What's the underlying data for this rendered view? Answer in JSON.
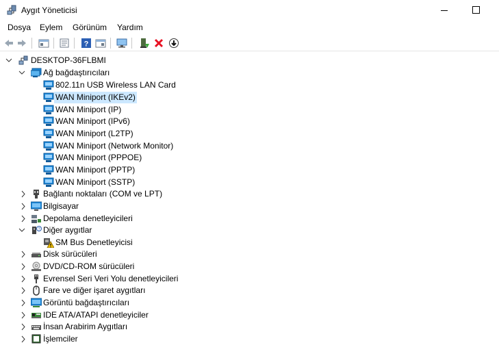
{
  "window": {
    "title": "Aygıt Yöneticisi"
  },
  "menu": [
    "Dosya",
    "Eylem",
    "Görünüm",
    "Yardım"
  ],
  "toolbar": {
    "icons": [
      "back-icon",
      "forward-icon",
      "show-hide-tree-icon",
      "properties-icon",
      "help-icon",
      "view-icon",
      "monitor-icon",
      "update-driver-icon",
      "uninstall-icon",
      "download-icon"
    ]
  },
  "tree": {
    "root": "DESKTOP-36FLBMI",
    "network": {
      "label": "Ağ bağdaştırıcıları",
      "items": [
        "802.11n USB Wireless LAN Card",
        "WAN Miniport (IKEv2)",
        "WAN Miniport (IP)",
        "WAN Miniport (IPv6)",
        "WAN Miniport (L2TP)",
        "WAN Miniport (Network Monitor)",
        "WAN Miniport (PPPOE)",
        "WAN Miniport (PPTP)",
        "WAN Miniport (SSTP)"
      ],
      "selected_index": 1
    },
    "categories_a": [
      "Bağlantı noktaları (COM ve LPT)",
      "Bilgisayar",
      "Depolama denetleyicileri"
    ],
    "other": {
      "label": "Diğer aygıtlar",
      "items": [
        "SM Bus Denetleyicisi"
      ]
    },
    "categories_b": [
      "Disk sürücüleri",
      "DVD/CD-ROM sürücüleri",
      "Evrensel Seri Veri Yolu denetleyicileri",
      "Fare ve diğer işaret aygıtları",
      "Görüntü bağdaştırıcıları",
      "IDE ATA/ATAPI denetleyiciler",
      "İnsan Arabirim Aygıtları",
      "İşlemciler"
    ]
  },
  "colors": {
    "selection": "#cce8ff",
    "network_icon": "#1e88d8",
    "uninstall": "#e81123"
  }
}
